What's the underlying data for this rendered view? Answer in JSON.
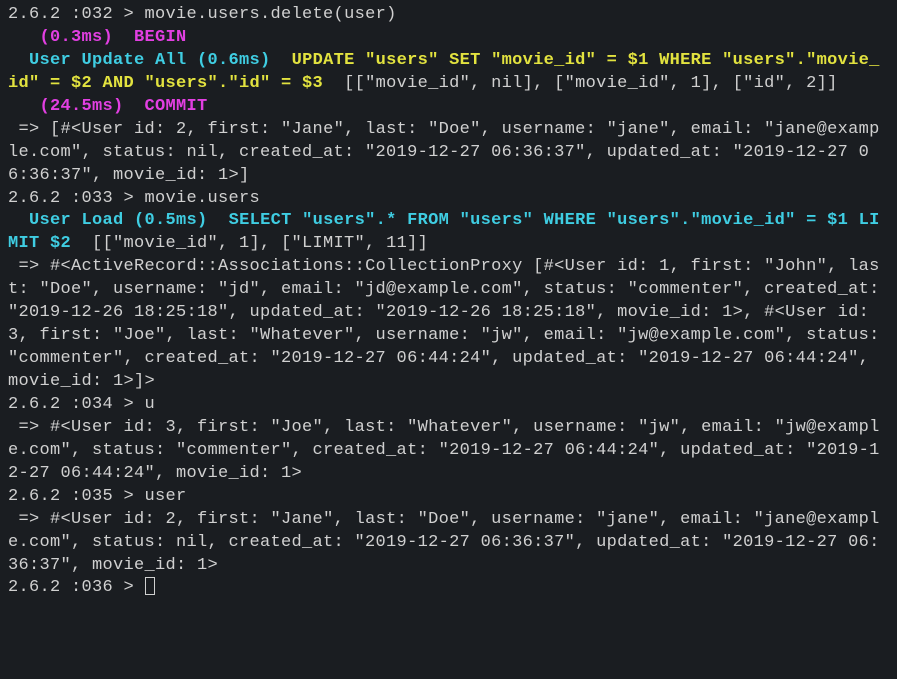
{
  "lines": [
    {
      "segments": [
        {
          "cls": "prompt",
          "text": "2.6.2 :032 > "
        },
        {
          "cls": "gray",
          "text": "movie.users.delete(user)"
        }
      ]
    },
    {
      "segments": [
        {
          "cls": "gray",
          "text": "   "
        },
        {
          "cls": "magenta-bold",
          "text": "(0.3ms)"
        },
        {
          "cls": "gray",
          "text": "  "
        },
        {
          "cls": "magenta-bold",
          "text": "BEGIN"
        }
      ]
    },
    {
      "segments": [
        {
          "cls": "gray",
          "text": "  "
        },
        {
          "cls": "cyan-bold",
          "text": "User Update All (0.6ms)"
        },
        {
          "cls": "gray",
          "text": "  "
        },
        {
          "cls": "yellow-bold",
          "text": "UPDATE \"users\" SET \"movie_id\" = $1 WHERE \"users\".\"movie_id\" = $2 AND \"users\".\"id\" = $3"
        },
        {
          "cls": "gray",
          "text": "  [[\"movie_id\", nil], [\"movie_id\", 1], [\"id\", 2]]"
        }
      ]
    },
    {
      "segments": [
        {
          "cls": "gray",
          "text": "   "
        },
        {
          "cls": "magenta-bold",
          "text": "(24.5ms)"
        },
        {
          "cls": "gray",
          "text": "  "
        },
        {
          "cls": "magenta-bold",
          "text": "COMMIT"
        }
      ]
    },
    {
      "segments": [
        {
          "cls": "gray",
          "text": " => [#<User id: 2, first: \"Jane\", last: \"Doe\", username: \"jane\", email: \"jane@example.com\", status: nil, created_at: \"2019-12-27 06:36:37\", updated_at: \"2019-12-27 06:36:37\", movie_id: 1>]"
        }
      ]
    },
    {
      "segments": [
        {
          "cls": "prompt",
          "text": "2.6.2 :033 > "
        },
        {
          "cls": "gray",
          "text": "movie.users"
        }
      ]
    },
    {
      "segments": [
        {
          "cls": "gray",
          "text": "  "
        },
        {
          "cls": "cyan-bold",
          "text": "User Load (0.5ms)"
        },
        {
          "cls": "gray",
          "text": "  "
        },
        {
          "cls": "cyan-bold",
          "text": "SELECT \"users\".* FROM \"users\" WHERE \"users\".\"movie_id\" = $1 LIMIT $2"
        },
        {
          "cls": "gray",
          "text": "  [[\"movie_id\", 1], [\"LIMIT\", 11]]"
        }
      ]
    },
    {
      "segments": [
        {
          "cls": "gray",
          "text": " => #<ActiveRecord::Associations::CollectionProxy [#<User id: 1, first: \"John\", last: \"Doe\", username: \"jd\", email: \"jd@example.com\", status: \"commenter\", created_at: \"2019-12-26 18:25:18\", updated_at: \"2019-12-26 18:25:18\", movie_id: 1>, #<User id: 3, first: \"Joe\", last: \"Whatever\", username: \"jw\", email: \"jw@example.com\", status: \"commenter\", created_at: \"2019-12-27 06:44:24\", updated_at: \"2019-12-27 06:44:24\", movie_id: 1>]>"
        }
      ]
    },
    {
      "segments": [
        {
          "cls": "prompt",
          "text": "2.6.2 :034 > "
        },
        {
          "cls": "gray",
          "text": "u"
        }
      ]
    },
    {
      "segments": [
        {
          "cls": "gray",
          "text": " => #<User id: 3, first: \"Joe\", last: \"Whatever\", username: \"jw\", email: \"jw@example.com\", status: \"commenter\", created_at: \"2019-12-27 06:44:24\", updated_at: \"2019-12-27 06:44:24\", movie_id: 1>"
        }
      ]
    },
    {
      "segments": [
        {
          "cls": "prompt",
          "text": "2.6.2 :035 > "
        },
        {
          "cls": "gray",
          "text": "user"
        }
      ]
    },
    {
      "segments": [
        {
          "cls": "gray",
          "text": " => #<User id: 2, first: \"Jane\", last: \"Doe\", username: \"jane\", email: \"jane@example.com\", status: nil, created_at: \"2019-12-27 06:36:37\", updated_at: \"2019-12-27 06:36:37\", movie_id: 1>"
        }
      ]
    },
    {
      "segments": [
        {
          "cls": "prompt",
          "text": "2.6.2 :036 > "
        }
      ],
      "cursor": true
    }
  ],
  "chart_data": null
}
